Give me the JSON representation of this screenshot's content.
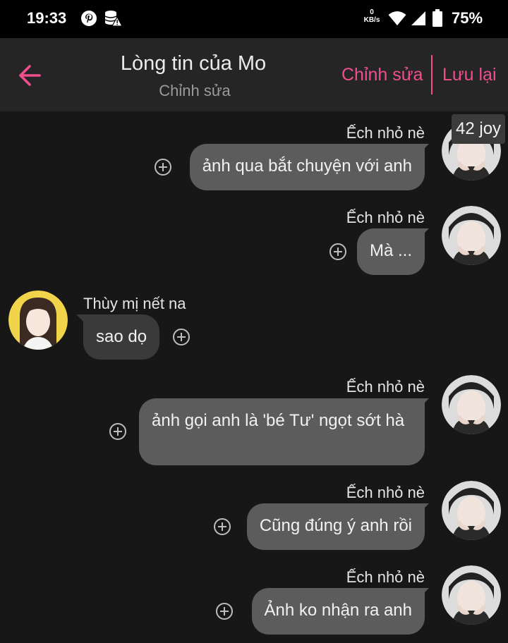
{
  "status": {
    "time": "19:33",
    "net_speed_value": "0",
    "net_speed_unit": "KB/s",
    "battery": "75%"
  },
  "header": {
    "title": "Lòng tin của Mo",
    "subtitle": "Chỉnh sửa",
    "edit_label": "Chỉnh sửa",
    "save_label": "Lưu lại"
  },
  "badge": "42 joy",
  "messages": [
    {
      "sender": "Ếch nhỏ nè",
      "side": "right",
      "text": "ảnh qua bắt chuyện với anh"
    },
    {
      "sender": "Ếch nhỏ nè",
      "side": "right",
      "text": "Mà ..."
    },
    {
      "sender": "Thùy mị nết na",
      "side": "left",
      "text": "sao dọ"
    },
    {
      "sender": "Ếch nhỏ nè",
      "side": "right",
      "text": "ảnh gọi anh là 'bé Tư' ngọt sớt hà"
    },
    {
      "sender": "Ếch nhỏ nè",
      "side": "right",
      "text": "Cũng đúng ý anh rồi"
    },
    {
      "sender": "Ếch nhỏ nè",
      "side": "right",
      "text": "Ảnh ko nhận ra anh"
    }
  ],
  "colors": {
    "accent": "#f24e8e",
    "bubble_right": "#5c5c5c",
    "bubble_left": "#3a3a3a",
    "background": "#171717"
  }
}
